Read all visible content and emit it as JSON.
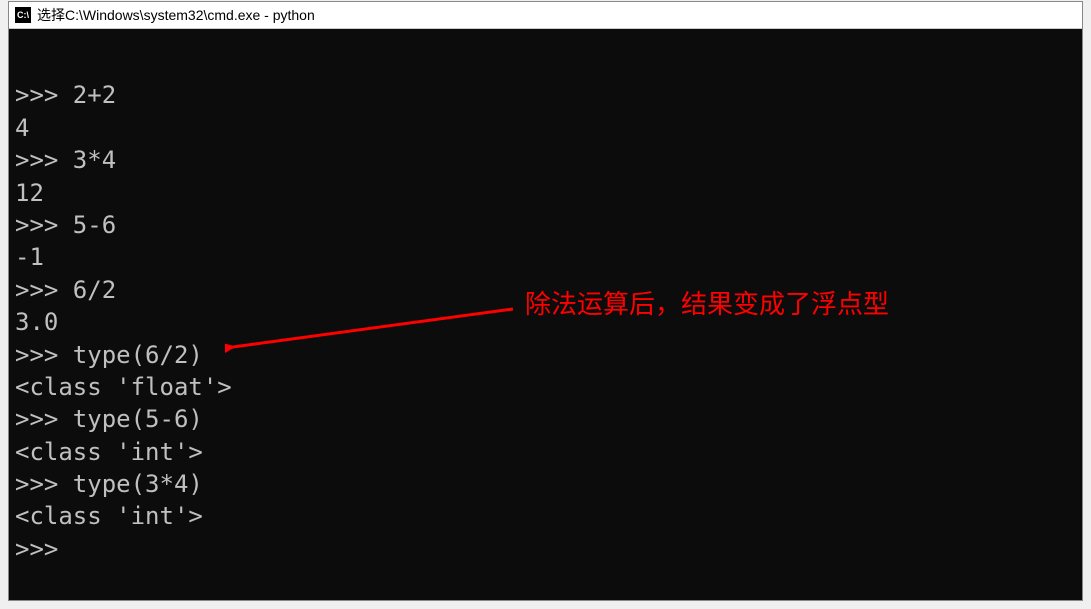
{
  "window": {
    "title": "选择C:\\Windows\\system32\\cmd.exe - python",
    "icon_label": "C:\\"
  },
  "terminal": {
    "lines": [
      ">>> 2+2",
      "4",
      ">>> 3*4",
      "12",
      ">>> 5-6",
      "-1",
      ">>> 6/2",
      "3.0",
      ">>> type(6/2)",
      "<class 'float'>",
      ">>> type(5-6)",
      "<class 'int'>",
      ">>> type(3*4)",
      "<class 'int'>",
      ">>>"
    ]
  },
  "annotation": {
    "text": "除法运算后，结果变成了浮点型",
    "color": "#ff0000"
  }
}
